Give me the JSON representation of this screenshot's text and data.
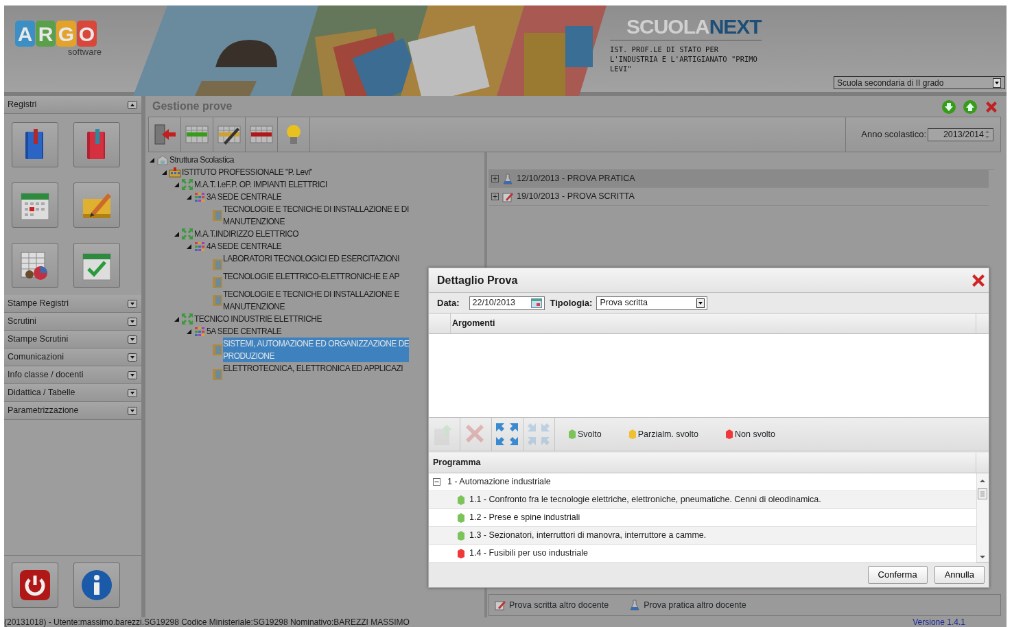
{
  "header": {
    "logo": {
      "letters": [
        {
          "text": "A",
          "color": "#3b8fc4"
        },
        {
          "text": "R",
          "color": "#5aa04a"
        },
        {
          "text": "G",
          "color": "#e3a22a"
        },
        {
          "text": "O",
          "color": "#d9473a"
        }
      ],
      "subtitle": "software"
    },
    "product_logo": {
      "first": "SCUOLA",
      "second": "NEXT"
    },
    "school_name_lines": [
      "IST. PROF.LE DI STATO PER",
      "L'INDUSTRIA E L'ARTIGIANATO \"PRIMO",
      "LEVI\""
    ],
    "school_type": "Scuola secondaria di II grado"
  },
  "sidebar": {
    "sections": [
      {
        "label": "Registri",
        "expanded": true
      },
      {
        "label": "Stampe Registri",
        "expanded": false
      },
      {
        "label": "Scrutini",
        "expanded": false
      },
      {
        "label": "Stampe Scrutini",
        "expanded": false
      },
      {
        "label": "Comunicazioni",
        "expanded": false
      },
      {
        "label": "Info classe / docenti",
        "expanded": false
      },
      {
        "label": "Didattica / Tabelle",
        "expanded": false
      },
      {
        "label": "Parametrizzazione",
        "expanded": false
      }
    ]
  },
  "main": {
    "title": "Gestione prove",
    "year_label": "Anno scolastico:",
    "year_value": "2013/2014",
    "tree": [
      {
        "kind": "root",
        "label": "Struttura Scolastica",
        "expanded": true,
        "children": [
          {
            "kind": "school",
            "label": "ISTITUTO PROFESSIONALE \"P. Levi\"",
            "expanded": true,
            "children": [
              {
                "kind": "course",
                "label": "M.A.T. I.eF.P. OP. IMPIANTI ELETTRICI",
                "expanded": true,
                "children": [
                  {
                    "kind": "class",
                    "label": "3A SEDE CENTRALE",
                    "expanded": true,
                    "children": [
                      {
                        "kind": "subject",
                        "lines": [
                          "TECNOLOGIE E TECNICHE DI INSTALLAZIONE E DI",
                          "MANUTENZIONE"
                        ],
                        "selected": false
                      }
                    ]
                  }
                ]
              },
              {
                "kind": "course",
                "label": "M.A.T.INDIRIZZO ELETTRICO",
                "expanded": true,
                "children": [
                  {
                    "kind": "class",
                    "label": "4A SEDE CENTRALE",
                    "expanded": true,
                    "children": [
                      {
                        "kind": "subject",
                        "lines": [
                          "LABORATORI TECNOLOGICI ED ESERCITAZIONI"
                        ],
                        "selected": false
                      },
                      {
                        "kind": "subject",
                        "lines": [
                          "TECNOLOGIE ELETTRICO-ELETTRONICHE E AP"
                        ],
                        "selected": false
                      },
                      {
                        "kind": "subject",
                        "lines": [
                          "TECNOLOGIE E TECNICHE DI INSTALLAZIONE E",
                          "MANUTENZIONE"
                        ],
                        "selected": false
                      }
                    ]
                  }
                ]
              },
              {
                "kind": "course",
                "label": "TECNICO INDUSTRIE ELETTRICHE",
                "expanded": true,
                "children": [
                  {
                    "kind": "class",
                    "label": "5A SEDE CENTRALE",
                    "expanded": true,
                    "children": [
                      {
                        "kind": "subject",
                        "lines": [
                          "SISTEMI, AUTOMAZIONE ED ORGANIZZAZIONE DE",
                          "PRODUZIONE"
                        ],
                        "selected": true
                      },
                      {
                        "kind": "subject",
                        "lines": [
                          "ELETTROTECNICA, ELETTRONICA ED APPLICAZI"
                        ],
                        "selected": false
                      }
                    ]
                  }
                ]
              }
            ]
          }
        ]
      }
    ],
    "tests": [
      {
        "kind": "pratica",
        "label": "12/10/2013 - PROVA PRATICA",
        "selected": true,
        "expanded": false
      },
      {
        "kind": "scritta",
        "label": "19/10/2013 - PROVA SCRITTA",
        "selected": false,
        "expanded": false
      }
    ],
    "legend": [
      {
        "kind": "scritta",
        "label": "Prova scritta altro docente"
      },
      {
        "kind": "pratica",
        "label": "Prova pratica altro docente"
      }
    ]
  },
  "status_bar": {
    "text": "(20131018) - Utente:massimo.barezzi.SG19298 Codice Ministeriale:SG19298 Nominativo:BAREZZI MASSIMO",
    "version": "Versione 1.4.1"
  },
  "dialog": {
    "title": "Dettaglio Prova",
    "date_label": "Data:",
    "date_value": "22/10/2013",
    "type_label": "Tipologia:",
    "type_value": "Prova scritta",
    "topics_header": "Argomenti",
    "toolbar": [
      {
        "kind": "import",
        "disabled": true
      },
      {
        "kind": "delete",
        "disabled": true
      },
      {
        "kind": "expand",
        "disabled": false
      },
      {
        "kind": "collapse",
        "disabled": true
      }
    ],
    "legend": [
      {
        "color": "#7cc35a",
        "label": "Svolto"
      },
      {
        "color": "#f0c030",
        "label": "Parzialm. svolto"
      },
      {
        "color": "#f03838",
        "label": "Non svolto"
      }
    ],
    "program_header": "Programma",
    "program": [
      {
        "label": "1 - Automazione industriale",
        "expanded": true,
        "children": [
          {
            "label": "1.1 - Confronto fra le tecnologie elettriche, elettroniche, pneumatiche. Cenni di oleodinamica.",
            "color": "#7cc35a"
          },
          {
            "label": "1.2 - Prese e spine industriali",
            "color": "#7cc35a"
          },
          {
            "label": "1.3 - Sezionatori, interruttori di manovra, interruttore a camme.",
            "color": "#7cc35a"
          },
          {
            "label": "1.4 - Fusibili per uso industriale",
            "color": "#f03838"
          }
        ]
      }
    ],
    "buttons": [
      "Conferma",
      "Annulla"
    ]
  }
}
